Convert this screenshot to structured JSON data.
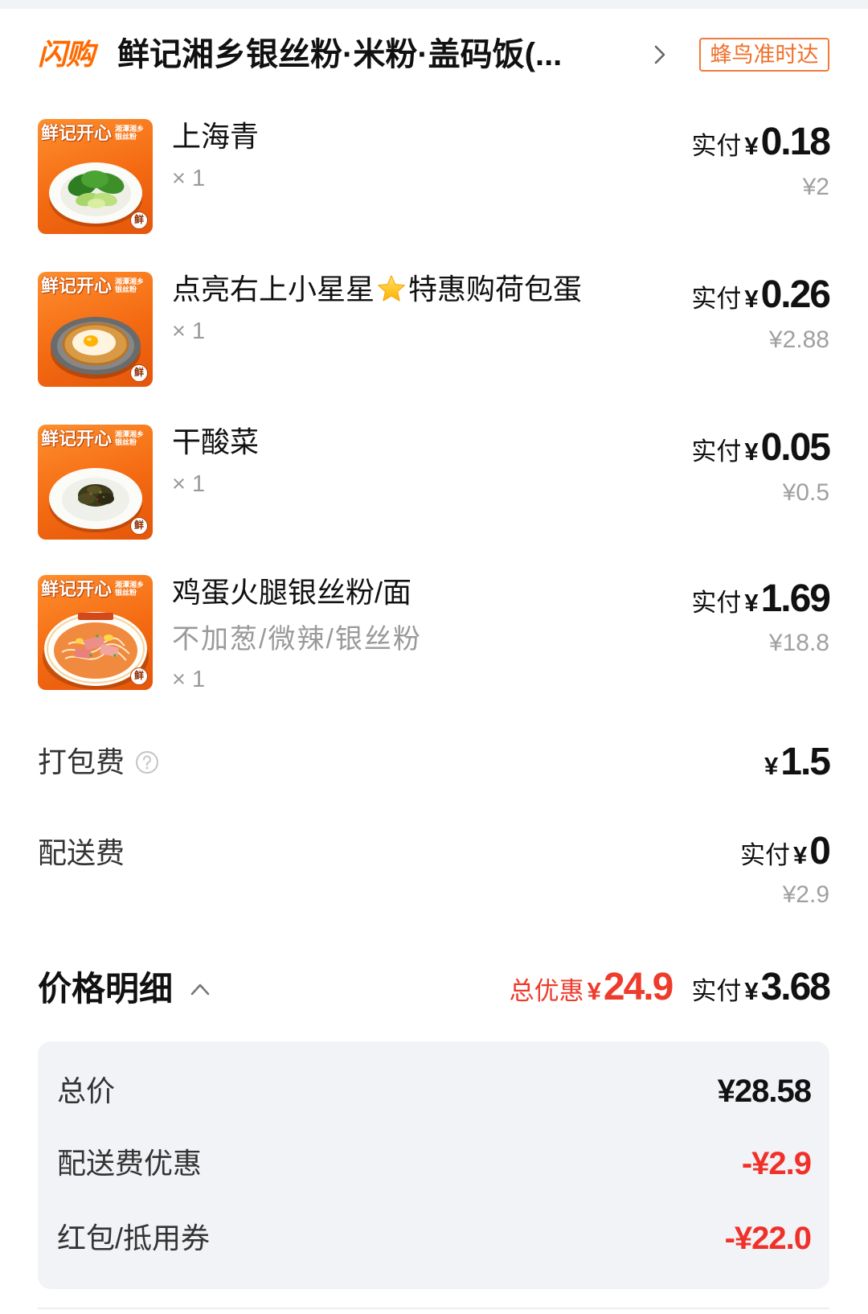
{
  "store": {
    "brand_logo": "闪购",
    "name": "鲜记湘乡银丝粉·米粉·盖码饭(...",
    "delivery_badge": "蜂鸟准时达"
  },
  "labels": {
    "paid": "实付",
    "currency": "¥"
  },
  "thumb_brand": {
    "title": "鲜记开心",
    "sub_line1": "湘潭湘乡",
    "sub_line2": "银丝粉",
    "stamp": "鲜"
  },
  "items": [
    {
      "name": "上海青",
      "qty": "× 1",
      "paid": "0.18",
      "original": "¥2",
      "thumb_icon": "bok-choy-dish"
    },
    {
      "name_part1": "点亮右上小星星",
      "name_icon": "star-icon",
      "name_part2": "特惠购荷包蛋",
      "qty": "× 1",
      "paid": "0.26",
      "original": "¥2.88",
      "thumb_icon": "fried-egg-dish"
    },
    {
      "name": "干酸菜",
      "qty": "× 1",
      "paid": "0.05",
      "original": "¥0.5",
      "thumb_icon": "pickled-vegetable-dish"
    },
    {
      "name": "鸡蛋火腿银丝粉/面",
      "spec": "不加葱/微辣/银丝粉",
      "qty": "× 1",
      "paid": "1.69",
      "original": "¥18.8",
      "thumb_icon": "noodle-bowl-dish"
    }
  ],
  "fees": {
    "packing": {
      "label": "打包费",
      "amount": "1.5",
      "icon": "help-icon"
    },
    "delivery": {
      "label": "配送费",
      "paid": "0",
      "original": "¥2.9"
    }
  },
  "summary": {
    "title": "价格明细",
    "toggle_icon": "chevron-up-icon",
    "discount_label": "总优惠",
    "discount_amount": "24.9",
    "paid_amount": "3.68",
    "rows": [
      {
        "label": "总价",
        "value": "¥28.58"
      },
      {
        "label": "配送费优惠",
        "value": "-¥2.9"
      },
      {
        "label": "红包/抵用券",
        "value": "-¥22.0"
      }
    ]
  },
  "colors": {
    "brand_orange": "#ff6a00",
    "badge_orange": "#f0702a",
    "discount_red": "#ee3b2b",
    "text_primary": "#111111",
    "text_secondary": "#9a9a9a",
    "detail_card_bg": "#f1f3f6"
  }
}
